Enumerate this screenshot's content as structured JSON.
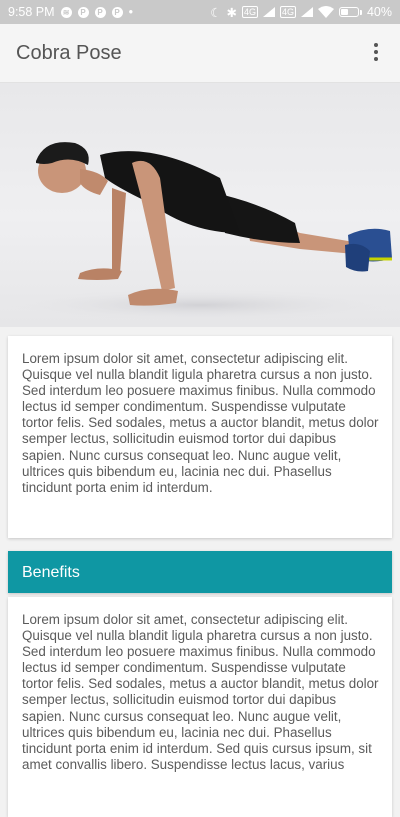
{
  "status_bar": {
    "time": "9:58 PM",
    "battery_percent": "40%",
    "battery_level": 0.4,
    "net_label_1": "4G",
    "net_label_2": "4G"
  },
  "app_bar": {
    "title": "Cobra Pose",
    "menu_icon": "more-vert-icon"
  },
  "hero": {
    "image_description_icon": "pushup-photo"
  },
  "intro": {
    "text": "Lorem ipsum dolor sit amet, consectetur adipiscing elit. Quisque vel nulla blandit ligula pharetra cursus a non justo. Sed interdum leo posuere maximus finibus. Nulla commodo lectus id semper condimentum. Suspendisse vulputate tortor felis. Sed sodales, metus a auctor blandit, metus dolor semper lectus, sollicitudin euismod tortor dui dapibus sapien. Nunc cursus consequat leo. Nunc augue velit, ultrices quis bibendum eu, lacinia nec dui. Phasellus tincidunt porta enim id interdum."
  },
  "benefits": {
    "header": "Benefits",
    "header_color": "#0f97a3",
    "text": "Lorem ipsum dolor sit amet, consectetur adipiscing elit. Quisque vel nulla blandit ligula pharetra cursus a non justo. Sed interdum leo posuere maximus finibus. Nulla commodo lectus id semper condimentum. Suspendisse vulputate tortor felis. Sed sodales, metus a auctor blandit, metus dolor semper lectus, sollicitudin euismod tortor dui dapibus sapien. Nunc cursus consequat leo. Nunc augue velit, ultrices quis bibendum eu, lacinia nec dui. Phasellus tincidunt porta enim id interdum. Sed quis cursus ipsum, sit amet convallis libero. Suspendisse lectus lacus, varius"
  }
}
